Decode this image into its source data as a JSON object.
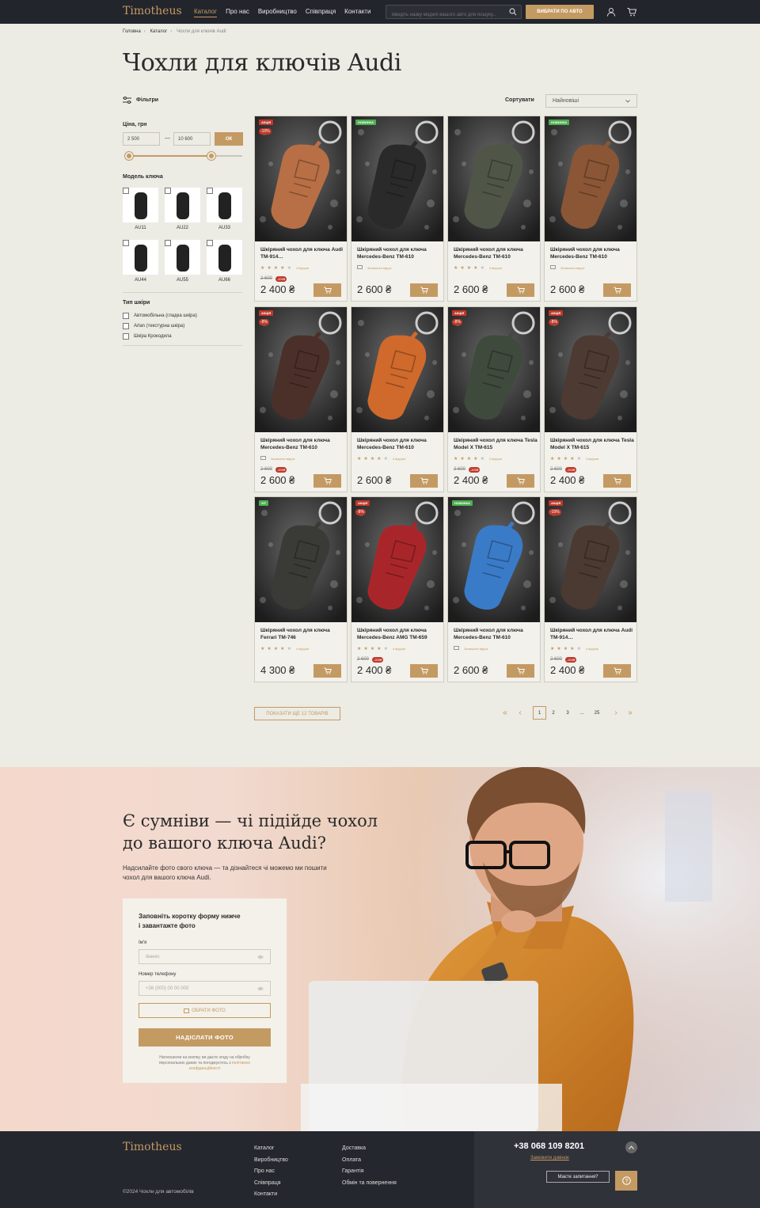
{
  "header": {
    "logo": "Timotheus",
    "nav": [
      "Каталог",
      "Про нас",
      "Виробництво",
      "Співпраця",
      "Контакти"
    ],
    "search_placeholder": "Введіть назву моделі вашого авто для пошуку...",
    "choose_button": "ВИБРАТИ ПО АВТО"
  },
  "breadcrumbs": [
    "Головна",
    "Каталог",
    "Чохли для ключів Audi"
  ],
  "title": "Чохли для ключів Audi",
  "filters": {
    "heading": "Фільтри",
    "price_label": "Ціна, грн",
    "price_from": "2 500",
    "price_to": "10 600",
    "ok": "ОК",
    "price_range_fraction": [
      0.0,
      0.78
    ],
    "model_label": "Модель ключа",
    "models": [
      "AU11",
      "AU22",
      "AU33",
      "AU44",
      "AU55",
      "AU66"
    ],
    "leather_label": "Тип шкіри",
    "leather_types": [
      "Автомобільна (гладка шкіра)",
      "Arlan (текстурна шкіра)",
      "Шкіра Крокодила"
    ]
  },
  "sort": {
    "label": "Сортувати",
    "value": "Найновіші"
  },
  "products": [
    {
      "badge": "АКЦІЯ",
      "badge_color": "#c0392b",
      "discount": "-10%",
      "title": "Шкіряний чохол для ключа Audi TM-914…",
      "rating": 4,
      "reviews": "4 відгуки",
      "old": "2 600",
      "old_badge": "-200₴",
      "price": "2 400 ₴",
      "color": "#b86f45"
    },
    {
      "badge": "НОВИНКА",
      "badge_color": "#4caf50",
      "discount": "",
      "title": "Шкіряний чохол для ключа Mercedes-Benz TM-610",
      "rating": 0,
      "reviews": "Залишити відгук",
      "old": "",
      "old_badge": "",
      "price": "2 600 ₴",
      "color": "#2a2a2a"
    },
    {
      "badge": "",
      "badge_color": "",
      "discount": "",
      "title": "Шкіряний чохол для ключа Mercedes-Benz TM-610",
      "rating": 4,
      "reviews": "4 відгуки",
      "old": "",
      "old_badge": "",
      "price": "2 600 ₴",
      "color": "#4f5648"
    },
    {
      "badge": "НОВИНКА",
      "badge_color": "#4caf50",
      "discount": "",
      "title": "Шкіряний чохол для ключа Mercedes-Benz TM-610",
      "rating": 0,
      "reviews": "Залишити відгук",
      "old": "",
      "old_badge": "",
      "price": "2 600 ₴",
      "color": "#8a5636"
    },
    {
      "badge": "АКЦІЯ",
      "badge_color": "#c0392b",
      "discount": "-8%",
      "title": "Шкіряний чохол для ключа Mercedes-Benz TM-610",
      "rating": 0,
      "reviews": "Залишити відгук",
      "old": "2 600",
      "old_badge": "-200₴",
      "price": "2 600 ₴",
      "color": "#4a3029"
    },
    {
      "badge": "",
      "badge_color": "",
      "discount": "",
      "title": "Шкіряний чохол для ключа Mercedes-Benz TM-610",
      "rating": 4,
      "reviews": "4 відгуки",
      "old": "",
      "old_badge": "",
      "price": "2 600 ₴",
      "color": "#cf6a2c"
    },
    {
      "badge": "АКЦІЯ",
      "badge_color": "#c0392b",
      "discount": "-8%",
      "title": "Шкіряний чохол для ключа Tesla Model X TM-615",
      "rating": 4,
      "reviews": "4 відгуки",
      "old": "2 600",
      "old_badge": "-200₴",
      "price": "2 400 ₴",
      "color": "#3e4a3c"
    },
    {
      "badge": "АКЦІЯ",
      "badge_color": "#c0392b",
      "discount": "-8%",
      "title": "Шкіряний чохол для ключа Tesla Model X TM-615",
      "rating": 4,
      "reviews": "4 відгуки",
      "old": "2 600",
      "old_badge": "-200₴",
      "price": "2 400 ₴",
      "color": "#4d3a33"
    },
    {
      "badge": "ХІТ",
      "badge_color": "#4caf50",
      "discount": "",
      "title": "Шкіряний чохол для ключа Ferrari TM-746",
      "rating": 4,
      "reviews": "4 відгуки",
      "old": "",
      "old_badge": "",
      "price": "4 300 ₴",
      "color": "#3a3a36"
    },
    {
      "badge": "АКЦІЯ",
      "badge_color": "#c0392b",
      "discount": "-8%",
      "title": "Шкіряний чохол для ключа Mercedes-Benz AMG TM-659",
      "rating": 4,
      "reviews": "4 відгуки",
      "old": "2 600",
      "old_badge": "-200₴",
      "price": "2 400 ₴",
      "color": "#a8262a"
    },
    {
      "badge": "НОВИНКА",
      "badge_color": "#4caf50",
      "discount": "",
      "title": "Шкіряний чохол для ключа Mercedes-Benz TM-610",
      "rating": 0,
      "reviews": "Залишити відгук",
      "old": "",
      "old_badge": "",
      "price": "2 600 ₴",
      "color": "#3a7bc8"
    },
    {
      "badge": "АКЦІЯ",
      "badge_color": "#c0392b",
      "discount": "-10%",
      "title": "Шкіряний чохол для ключа Audi TM-914…",
      "rating": 4,
      "reviews": "4 відгуки",
      "old": "2 600",
      "old_badge": "-200₴",
      "price": "2 400 ₴",
      "color": "#4a3a31"
    }
  ],
  "pagination": {
    "more": "ПОКАЗАТИ ЩЕ 12 ТОВАРІВ",
    "pages": [
      "1",
      "2",
      "3",
      "...",
      "25"
    ],
    "current": "1"
  },
  "promo": {
    "title_line1": "Є сумніви — чі підійде чохол",
    "title_line2": "до вашого ключа Audi?",
    "subtitle": "Надсилайте фото свого ключа — та дізнайтеся чі можемо ми пошити чохол для вашого ключа Audi.",
    "form_title": "Заповніть коротку форму нижче і завантажте фото",
    "name_label": "Ім'я",
    "name_placeholder": "Іванко",
    "phone_label": "Номер телефону",
    "phone_placeholder": "+38 (000) 00 00 000",
    "photo_button": "ОБРАТИ ФОТО",
    "submit": "НАДІСЛАТИ ФОТО",
    "note": "Натискаючи на кнопку, ви даєте згоду на обробку персональних даних та погоджуєтесь з",
    "note_link": "політикою конфіденційності"
  },
  "footer": {
    "logo": "Timotheus",
    "copyright": "©2024 Чохли для автомобілів",
    "col1": [
      "Каталог",
      "Виробництво",
      "Про нас",
      "Співпраця",
      "Контакти"
    ],
    "col2": [
      "Доставка",
      "Оплата",
      "Гарантія",
      "Обмін та повернення"
    ],
    "phone": "+38 068 109 8201",
    "callback": "Замовити дзвінок",
    "question": "Маєте запитання?"
  },
  "colors": {
    "accent": "#c49a63",
    "dark": "#23252c",
    "bg": "#ecebe4"
  }
}
